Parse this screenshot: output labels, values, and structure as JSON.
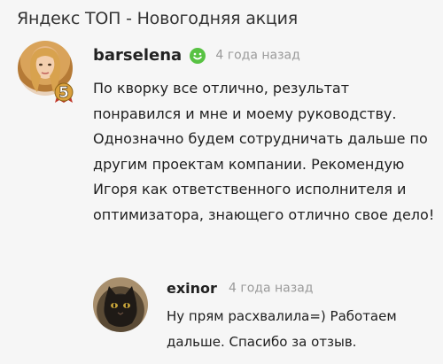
{
  "page": {
    "title": "Яндекс ТОП - Новогодняя акция"
  },
  "review": {
    "username": "barselena",
    "time": "4 года назад",
    "level": "5",
    "mood_icon": "smile-icon",
    "text": "По кворку все отлично, результат понравился и мне и моему руководству. Однозначно будем сотрудничать дальше по другим проектам компании. Рекомендую Игоря как ответственного исполнителя и оптимизатора, знающего отлично свое дело!"
  },
  "reply": {
    "username": "exinor",
    "time": "4 года назад",
    "text": "Ну прям расхвалила=) Работаем дальше. Спасибо за отзыв."
  },
  "colors": {
    "background": "#f6f6f6",
    "smile": "#58c243",
    "badge": "#d9a03c",
    "muted_text": "#9a9a9a"
  }
}
